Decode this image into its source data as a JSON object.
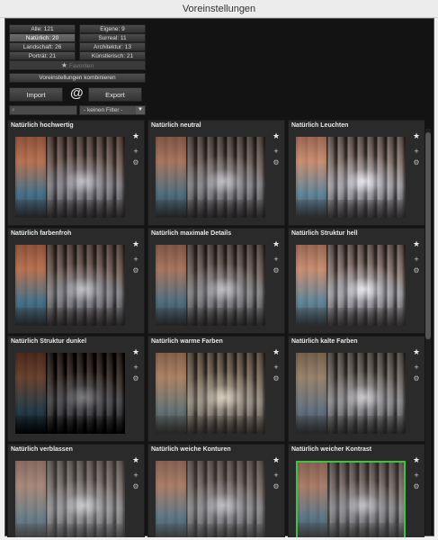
{
  "window": {
    "title": "Voreinstellungen"
  },
  "categories": [
    {
      "label": "Alle: 121",
      "active": false
    },
    {
      "label": "Eigene: 9",
      "active": false
    },
    {
      "label": "Natürlich: 20",
      "active": true
    },
    {
      "label": "Surreal: 11",
      "active": false
    },
    {
      "label": "Landschaft: 26",
      "active": false
    },
    {
      "label": "Architektur: 13",
      "active": false
    },
    {
      "label": "Porträt: 21",
      "active": false
    },
    {
      "label": "Künstlerisch: 21",
      "active": false
    }
  ],
  "favorites": {
    "label": "Favoriten"
  },
  "combine": {
    "label": "Voreinstellungen kombinieren"
  },
  "io": {
    "import": "Import",
    "export": "Export"
  },
  "search": {
    "value": ""
  },
  "filter": {
    "selected": "- keinen Filter -"
  },
  "presets": [
    {
      "name": "Natürlich hochwertig",
      "style": "f-vivid",
      "selected": false
    },
    {
      "name": "Natürlich neutral",
      "style": "",
      "selected": false
    },
    {
      "name": "Natürlich Leuchten",
      "style": "f-bright",
      "selected": false
    },
    {
      "name": "Natürlich farbenfroh",
      "style": "f-vivid",
      "selected": false
    },
    {
      "name": "Natürlich maximale Details",
      "style": "",
      "selected": false
    },
    {
      "name": "Natürlich Struktur hell",
      "style": "f-bright",
      "selected": false
    },
    {
      "name": "Natürlich Struktur dunkel",
      "style": "f-dark",
      "selected": false
    },
    {
      "name": "Natürlich warme Farben",
      "style": "f-warm",
      "selected": false
    },
    {
      "name": "Natürlich kalte Farben",
      "style": "f-cold",
      "selected": false
    },
    {
      "name": "Natürlich verblassen",
      "style": "f-fade",
      "selected": false
    },
    {
      "name": "Natürlich weiche Konturen",
      "style": "f-soft",
      "selected": false
    },
    {
      "name": "Natürlich weicher Kontrast",
      "style": "f-soft",
      "selected": true
    }
  ],
  "icons": {
    "favorite": "star-icon",
    "add": "plus-icon",
    "settings": "gear-icon",
    "search": "search-icon",
    "dropdown": "chevron-down-icon",
    "email": "at-icon"
  },
  "colors": {
    "selection": "#42c042",
    "panel": "#131313",
    "card": "#2a2a2a"
  }
}
